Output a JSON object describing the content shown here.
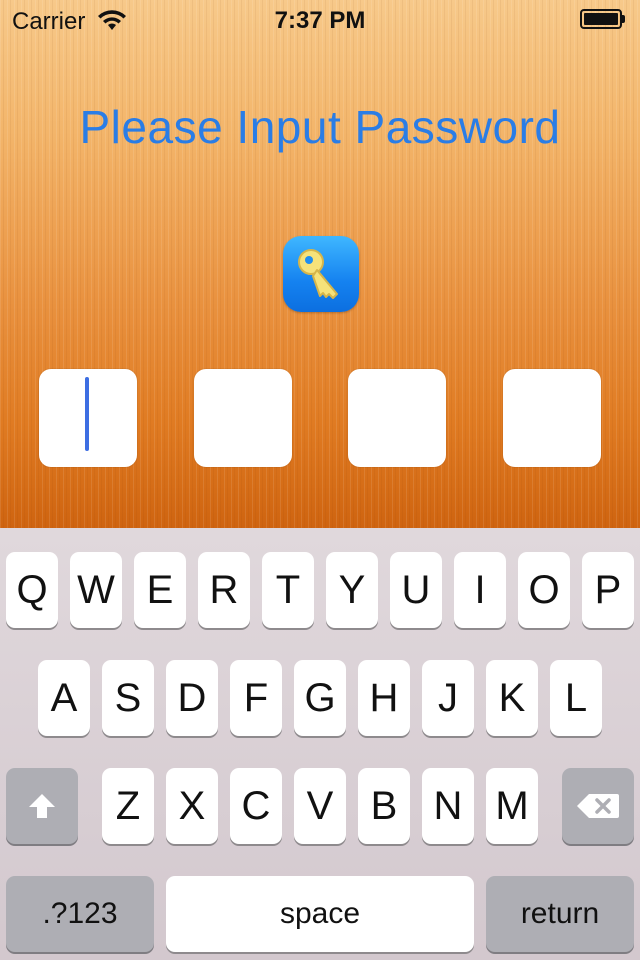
{
  "status_bar": {
    "carrier": "Carrier",
    "time": "7:37 PM",
    "wifi_icon": "wifi-icon",
    "battery_icon": "battery-icon"
  },
  "screen": {
    "title": "Please Input Password",
    "icon": "key-icon",
    "accent_color": "#2a7de6",
    "pin_slots": [
      "",
      "",
      "",
      ""
    ],
    "active_slot": 1
  },
  "keyboard": {
    "row1": [
      "Q",
      "W",
      "E",
      "R",
      "T",
      "Y",
      "U",
      "I",
      "O",
      "P"
    ],
    "row2": [
      "A",
      "S",
      "D",
      "F",
      "G",
      "H",
      "J",
      "K",
      "L"
    ],
    "row3": [
      "Z",
      "X",
      "C",
      "V",
      "B",
      "N",
      "M"
    ],
    "shift_icon": "shift-arrow-icon",
    "delete_icon": "backspace-icon",
    "numbers_label": ".?123",
    "space_label": "space",
    "return_label": "return"
  }
}
